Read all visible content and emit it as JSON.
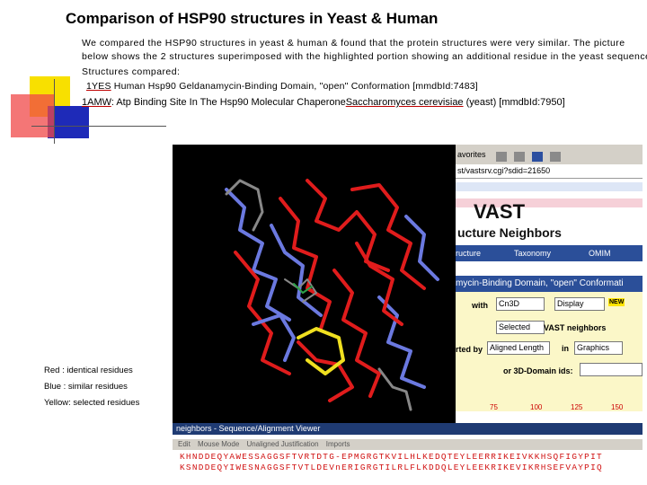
{
  "title": "Comparison of HSP90 structures in Yeast & Human",
  "intro_line1": "We compared the HSP90 structures in yeast & human & found that the protein structures were very similar. The picture",
  "intro_line2": "below shows the 2 structures superimposed with the highlighted portion showing an additional residue in the yeast sequence.",
  "compared_label": "Structures compared:",
  "structure1": {
    "id": "1YES",
    "desc": "Human Hsp90 Geldanamycin-Binding Domain, \"open\" Conformation [mmdbId:7483]"
  },
  "structure2": {
    "id": "1AMW",
    "desc_before": ": Atp Binding Site In The Hsp90 Molecular Chaperone",
    "organism": "Saccharomyces cerevisiae",
    "desc_after": " (yeast) [mmdbId:7950]"
  },
  "legend": {
    "red": "Red : identical residues",
    "blue": "Blue : similar residues",
    "yellow": "Yellow: selected residues"
  },
  "colors": {
    "red": "#e01c1c",
    "blue": "#6b79e0",
    "yellow": "#f0e020",
    "link_underline": "#c00000"
  },
  "browser": {
    "favorites": "avorites",
    "url": "st/vastsrv.cgi?sdid=21650",
    "vast_logo": "VAST",
    "neighbors_heading": "ucture Neighbors",
    "tabs": [
      "ructure",
      "Taxonomy",
      "OMIM"
    ],
    "domain_banner": "mycin-Binding Domain, \"open\" Conformati",
    "with_label": "with",
    "with_select": "Cn3D",
    "display_select": "Display",
    "new_badge": "NEW",
    "selected_select": "Selected",
    "vast_neighbors": "VAST neighbors",
    "sorted_by": "rted by",
    "aligned_length": "Aligned Length",
    "in_label": "in",
    "graphics_select": "Graphics",
    "domain_ids": "or 3D-Domain ids:",
    "ruler": [
      "75",
      "100",
      "125",
      "150"
    ]
  },
  "seq_viewer": {
    "title": "neighbors - Sequence/Alignment Viewer",
    "menu": [
      "Edit",
      "Mouse Mode",
      "Unaligned Justification",
      "Imports"
    ],
    "row1": "KHNDDEQYAWESSAGGSFTVRTDTG-EPMGRGTKVILHLKEDQTEYLEERRIKEIVKKHSQFIGYPIT",
    "row2": "KSNDDEQYIWESNAGGSFTVTLDEVnERIGRGTILRLFLKDDQLEYLEEKRIKEVIKRHSEFVAYPIQ"
  }
}
